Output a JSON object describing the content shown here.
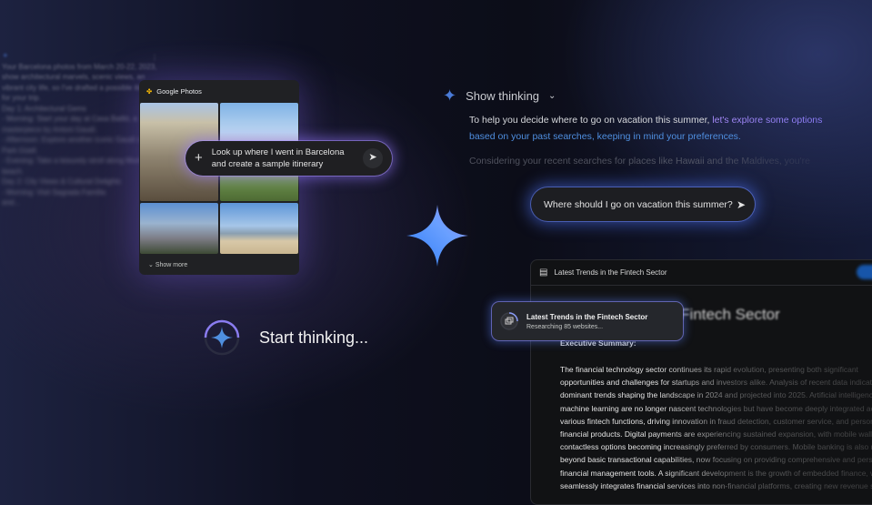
{
  "left_chat": {
    "lines": [
      "Your Barcelona photos from March 20-22, 2023,",
      "show architectural marvels, scenic views, an",
      "vibrant city life, so I've drafted a possible itin",
      "for your trip.",
      "Day 1: Architectural Gems",
      "- Morning: Start your day at Casa Batlló, a",
      "masterpiece by Antoni Gaudí.",
      "- Afternoon: Explore another iconic Gaudí s",
      "Park Güell.",
      "- Evening: Take a leisurely stroll along Munt",
      "beach.",
      "Day 2: City Views & Cultural Delights",
      "- Morning: Visit Sagrada Família",
      "and..."
    ]
  },
  "photos_card": {
    "title": "Google Photos",
    "show_more": "Show more"
  },
  "barcelona_prompt": {
    "text_line1": "Look up where I went in Barcelona",
    "text_line2": "and create a sample itinerary"
  },
  "start_thinking": {
    "label": "Start thinking..."
  },
  "thinking": {
    "toggle": "Show thinking",
    "para_plain": "To help you decide where to go on vacation this summer, ",
    "para_grad1": "let's explore some options",
    "para_grad2": "based on your past searches, keeping in mind your preferences.",
    "faded": "Considering your recent searches for places like Hawaii and the Maldives, you're"
  },
  "vacation_prompt": {
    "text": "Where should I go on vacation this summer?"
  },
  "report": {
    "header": "Latest Trends in the Fintech Sector",
    "big_title": "e Fintech Sector",
    "exec": "Executive Summary:",
    "lines": [
      "The financial technology sector continues its rapid evolution, presenting both significant",
      "opportunities and challenges for startups and investors alike. Analysis of recent data indicates",
      "dominant trends shaping the landscape in 2024 and projected into 2025. Artificial intelligence",
      "machine learning are no longer nascent technologies but have become deeply integrated acr",
      "various fintech functions, driving innovation in fraud detection, customer service, and persona",
      "financial products. Digital payments are experiencing sustained expansion, with mobile wallets",
      "contactless options becoming increasingly preferred by consumers. Mobile banking is also mo",
      "beyond basic transactional capabilities, now focusing on providing comprehensive and person",
      "financial management tools. A significant development is the growth of embedded finance, wh",
      "seamlessly integrates financial services into non-financial platforms, creating new revenue st"
    ]
  },
  "research_card": {
    "title": "Latest Trends in the Fintech Sector",
    "status": "Researching 85 websites..."
  },
  "colors": {
    "accent_blue": "#4f8fe0",
    "accent_purple": "#a78bfa"
  }
}
